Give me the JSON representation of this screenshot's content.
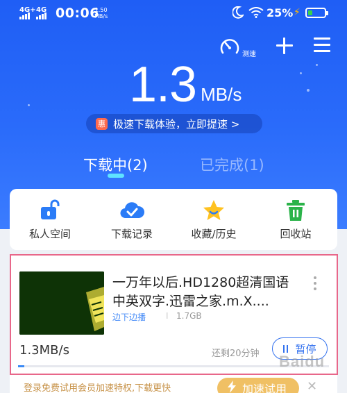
{
  "status_bar": {
    "net1": "4G+",
    "net2": "4G",
    "time": "00:06",
    "net_speed_value": "1.50",
    "net_speed_unit": "MB/s",
    "battery": "25%"
  },
  "toolbar": {
    "speedtest_label": "测速"
  },
  "header": {
    "speed_value": "1.3",
    "speed_unit": "MB/s",
    "promo_badge": "惠",
    "promo_text": "极速下载体验，立即提速 >"
  },
  "tabs": [
    {
      "label": "下载中(2)",
      "active": true
    },
    {
      "label": "已完成(1)",
      "active": false
    }
  ],
  "shortcuts": [
    {
      "label": "私人空间",
      "icon": "lock-icon"
    },
    {
      "label": "下载记录",
      "icon": "cloud-check-icon"
    },
    {
      "label": "收藏/历史",
      "icon": "star-icon"
    },
    {
      "label": "回收站",
      "icon": "trash-icon"
    }
  ],
  "task": {
    "title": "一万年以后.HD1280超清国语中英双字.迅雷之家.m.X....",
    "play_tag": "边下边播",
    "separator": "I",
    "size": "1.7GB",
    "speed": "1.3MB/s",
    "remaining": "还剩20分钟",
    "pause_label": "暂停",
    "progress": 0.02
  },
  "bottom_promo": {
    "text": "登录免费试用会员加速特权,下载更快",
    "button_label": "加速试用"
  },
  "watermark": "Baidu经验",
  "colors": {
    "brand_blue": "#2a6bfa",
    "highlight_border": "#e8678a",
    "accent_cyan": "#5fe3ff",
    "gold": "#f0c064"
  }
}
